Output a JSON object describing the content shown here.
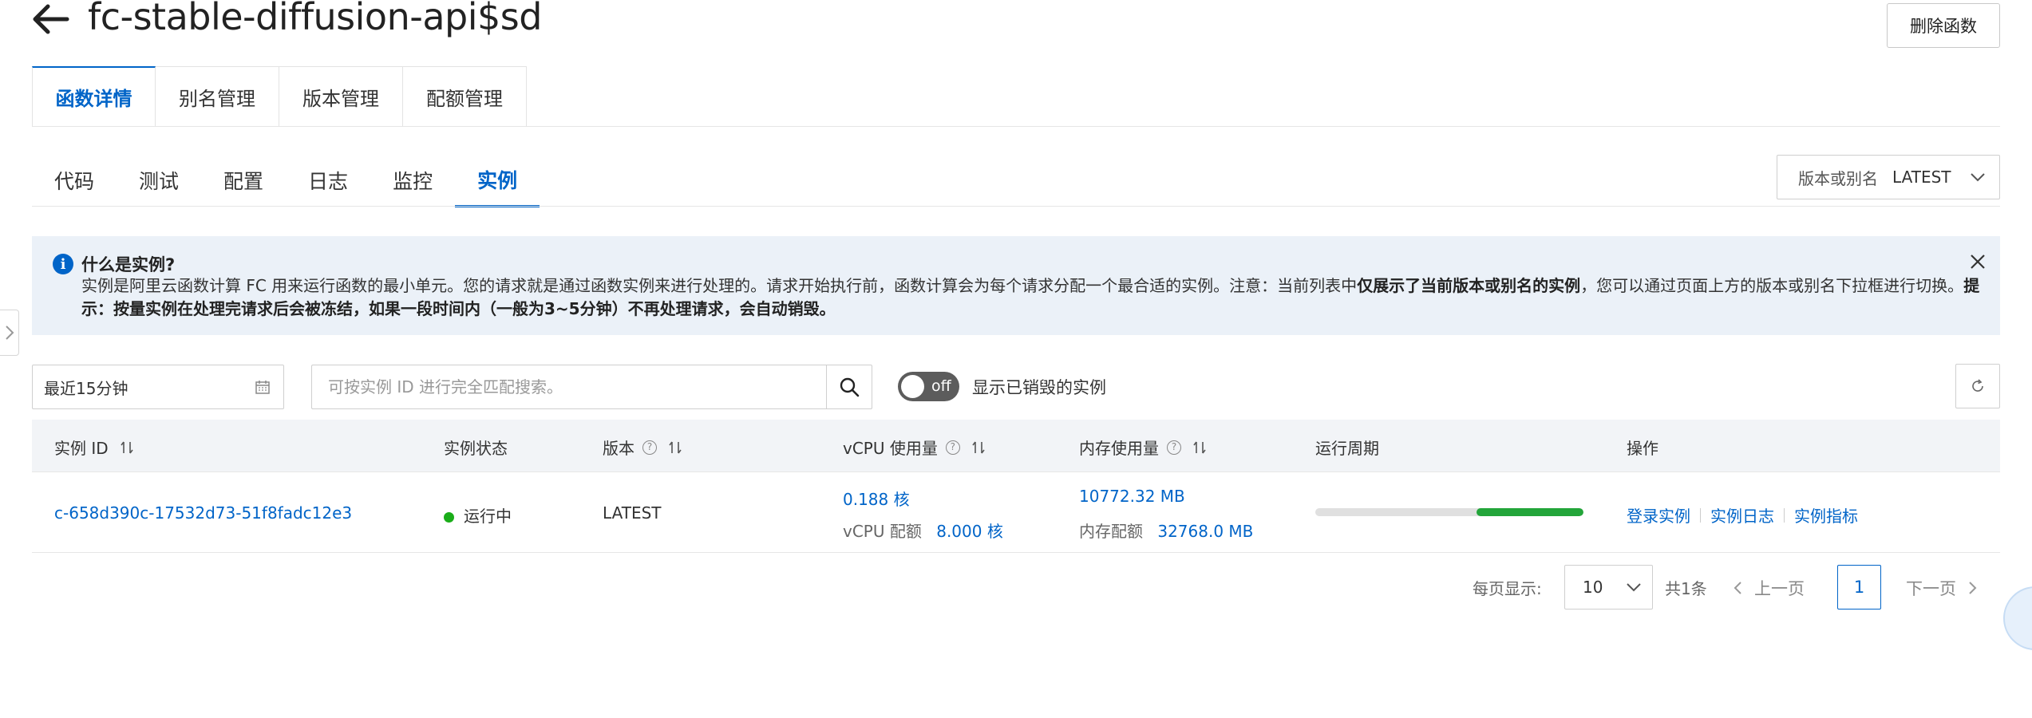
{
  "header": {
    "title": "fc-stable-diffusion-api$sd",
    "delete_label": "删除函数"
  },
  "top_tabs": [
    {
      "label": "函数详情"
    },
    {
      "label": "别名管理"
    },
    {
      "label": "版本管理"
    },
    {
      "label": "配额管理"
    }
  ],
  "sub_tabs": [
    {
      "label": "代码"
    },
    {
      "label": "测试"
    },
    {
      "label": "配置"
    },
    {
      "label": "日志"
    },
    {
      "label": "监控"
    },
    {
      "label": "实例"
    }
  ],
  "version_select": {
    "label": "版本或别名",
    "value": "LATEST"
  },
  "banner": {
    "title": "什么是实例?",
    "text_1": "实例是阿里云函数计算 FC 用来运行函数的最小单元。您的请求就是通过函数实例来进行处理的。请求开始执行前，函数计算会为每个请求分配一个最合适的实例。注意：当前列表中",
    "bold_1": "仅展示了当前版本或别名的实例",
    "text_2": "，您可以通过页面上方的版本或别名下拉框进行切换。",
    "bold_2": "提示：按量实例在处理完请求后会被冻结，如果一段时间内（一般为3~5分钟）不再处理请求，会自动销毁。"
  },
  "toolbar": {
    "time_range": "最近15分钟",
    "search_placeholder": "可按实例 ID 进行完全匹配搜索。",
    "toggle_state": "off",
    "toggle_label": "显示已销毁的实例"
  },
  "table": {
    "headers": {
      "instance_id": "实例 ID",
      "status": "实例状态",
      "version": "版本",
      "vcpu": "vCPU 使用量",
      "memory": "内存使用量",
      "lifecycle": "运行周期",
      "actions": "操作"
    },
    "rows": [
      {
        "instance_id": "c-658d390c-17532d73-51f8fadc12e3",
        "status": "运行中",
        "version": "LATEST",
        "vcpu_used": "0.188 核",
        "vcpu_quota_label": "vCPU 配额",
        "vcpu_quota": "8.000 核",
        "mem_used": "10772.32 MB",
        "mem_quota_label": "内存配额",
        "mem_quota": "32768.0 MB",
        "lifecycle_start": 0.6,
        "lifecycle_end": 1.0,
        "actions": [
          "登录实例",
          "实例日志",
          "实例指标"
        ]
      }
    ]
  },
  "pagination": {
    "page_size_label": "每页显示:",
    "page_size": "10",
    "total": "共1条",
    "prev": "上一页",
    "current": "1",
    "next": "下一页"
  },
  "colors": {
    "primary": "#0064c8",
    "running": "#1aad19",
    "lifecycle_fill": "#23a53a"
  }
}
